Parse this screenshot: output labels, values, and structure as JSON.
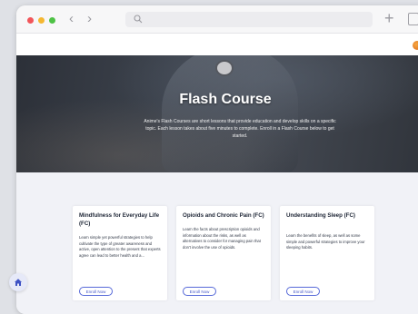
{
  "browser": {
    "back_glyph": "‹",
    "forward_glyph": "›",
    "new_tab_glyph": "+",
    "icons": [
      "back-icon",
      "forward-icon",
      "search-icon",
      "plus-icon",
      "tabs-icon",
      "avatar",
      "home-icon"
    ]
  },
  "hero": {
    "title": "Flash Course",
    "description": "Anime's Flash Courses are short lessons that provide education and develop skills on a specific topic. Each lesson takes about five minutes to complete. Enroll in a Flash Course below to get started."
  },
  "courses": [
    {
      "title": "Mindfulness for Everyday Life (FC)",
      "description": "Learn simple yet powerful strategies to help cultivate the type of greater awareness and active, open attention to the present that experts agree can lead to better health and a...",
      "button": "Enroll Now"
    },
    {
      "title": "Opioids and Chronic Pain (FC)",
      "description": "Learn the facts about prescription opioids and information about the risks, as well as alternatives to consider for managing pain that don't involve the use of opioids.",
      "button": "Enroll Now"
    },
    {
      "title": "Understanding Sleep (FC)",
      "description": "Learn the benefits of sleep, as well as some simple and powerful strategies to improve your sleeping habits.",
      "button": "Enroll Now"
    }
  ],
  "colors": {
    "accent": "#4558c9",
    "hero_bg": "#3c424c",
    "page_bg": "#f1f2f7",
    "traffic_red": "#f2555a",
    "traffic_yellow": "#f5b731",
    "traffic_green": "#4ec245"
  }
}
